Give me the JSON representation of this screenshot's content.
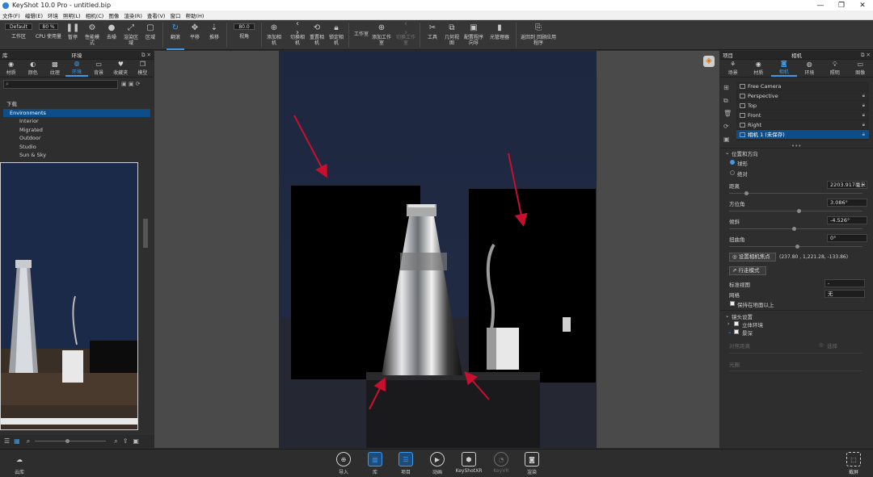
{
  "window": {
    "title": "KeyShot 10.0 Pro  - untitled.bip",
    "min": "—",
    "max": "❐",
    "close": "✕"
  },
  "menu": [
    "文件(F)",
    "编辑(E)",
    "环境",
    "照明(L)",
    "相机(C)",
    "图像",
    "渲染(R)",
    "查看(V)",
    "窗口",
    "帮助(H)"
  ],
  "toolbar": {
    "workspace_value": "Default",
    "zoom_value": "80 %",
    "workspace_label": "工作区",
    "cpu_label": "CPU 使用量",
    "pause_label": "暂停",
    "perf_label": "性能模式",
    "denoise_label": "去噪",
    "render_region_label": "渲染区域",
    "region_label": "区域",
    "tumble_label": "翻滚",
    "pan_label": "平移",
    "dolly_label": "推移",
    "fov_value": "80.0",
    "fov_label": "视角",
    "add_camera_label": "添加相机",
    "switch_camera_label": "切换相机",
    "reset_camera_label": "重置相机",
    "lock_camera_label": "锁定相机",
    "studio_label": "工作室",
    "add_studio_label": "添加工作室",
    "switch_studio_label": "切换工作室",
    "tools_label": "工具",
    "geometry_label": "几何视图",
    "config_label": "配置程序向导",
    "light_manager_label": "光管理器",
    "go_app_label": "返回到 回顾应用程序"
  },
  "left_panel": {
    "head_left": "库",
    "title": "环境",
    "tabs": [
      {
        "label": "材质",
        "icon": "material-icon"
      },
      {
        "label": "颜色",
        "icon": "color-icon"
      },
      {
        "label": "纹理",
        "icon": "texture-icon"
      },
      {
        "label": "环境",
        "icon": "environment-icon"
      },
      {
        "label": "背景",
        "icon": "background-icon"
      },
      {
        "label": "收藏夹",
        "icon": "favorites-icon"
      },
      {
        "label": "模型",
        "icon": "model-icon"
      }
    ],
    "tree": [
      "下载",
      "Environments",
      "Interior",
      "Migrated",
      "Outdoor",
      "Studio",
      "Sun & Sky"
    ]
  },
  "right_panel": {
    "head_left": "项目",
    "title": "相机",
    "tabs": [
      {
        "label": "场景",
        "icon": "scene-icon"
      },
      {
        "label": "材质",
        "icon": "material-icon"
      },
      {
        "label": "相机",
        "icon": "camera-icon"
      },
      {
        "label": "环境",
        "icon": "environment-icon"
      },
      {
        "label": "照明",
        "icon": "lighting-icon"
      },
      {
        "label": "图像",
        "icon": "image-icon"
      }
    ],
    "cameras": [
      "Free Camera",
      "Perspective",
      "Top",
      "Front",
      "Right",
      "相机 1 (未保存)"
    ],
    "section_position": "位置和方向",
    "mode_orbit": "球形",
    "mode_absolute": "绝对",
    "distance_label": "距离",
    "distance_value": "2203.917毫米",
    "azimuth_label": "方位角",
    "azimuth_value": "3.086°",
    "incline_label": "倾斜",
    "incline_value": "-4.526°",
    "twist_label": "扭曲角",
    "twist_value": "0°",
    "set_focus_label": "设置相机焦点",
    "focus_coords": "(237.80 , 1,221.28, -133.86)",
    "walk_mode_label": "行走模式",
    "std_view_label": "标准视图",
    "std_view_value": "-",
    "grid_label": "网格",
    "grid_value": "无",
    "keep_above_label": "保持在地面以上",
    "lens_section": "镜头设置",
    "stereo_label": "立体环境",
    "dof_label": "景深",
    "focus_dist_label": "对焦距离",
    "pick_focus_label": "选择",
    "aperture_label": "光圈"
  },
  "viewport": {
    "corner_icon": "render-status-icon"
  },
  "bottombar": {
    "library_label": "云库",
    "import_label": "导入",
    "lib_label": "库",
    "project_label": "项目",
    "animation_label": "动画",
    "keyshotxr_label": "KeyShotXR",
    "keyvr_label": "KeyVR",
    "render_label": "渲染",
    "screenshot_label": "截屏"
  },
  "colors": {
    "accent": "#3d9bea",
    "selection": "#0d4e8a",
    "arrow": "#c8102e",
    "viewport_bg": "#4a4a4a",
    "scene_backdrop": "#1e2538"
  }
}
